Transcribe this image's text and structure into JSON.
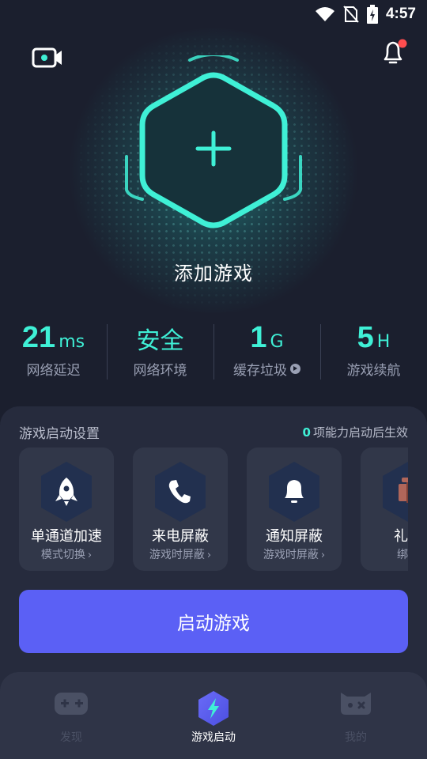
{
  "status_bar": {
    "time": "4:57"
  },
  "hero": {
    "add_game_label": "添加游戏"
  },
  "stats": [
    {
      "value": "21",
      "unit": "ms",
      "label": "网络延迟"
    },
    {
      "value": "安全",
      "unit": "",
      "label": "网络环境"
    },
    {
      "value": "1",
      "unit": "G",
      "label": "缓存垃圾"
    },
    {
      "value": "5",
      "unit": "H",
      "label": "游戏续航"
    }
  ],
  "settings": {
    "title": "游戏启动设置",
    "note_count": "0",
    "note_text": "项能力启动后生效",
    "cards": [
      {
        "title": "单通道加速",
        "subtitle": "模式切换",
        "icon": "rocket-icon"
      },
      {
        "title": "来电屏蔽",
        "subtitle": "游戏时屏蔽",
        "icon": "phone-icon"
      },
      {
        "title": "通知屏蔽",
        "subtitle": "游戏时屏蔽",
        "icon": "bell-icon"
      },
      {
        "title": "礼包",
        "subtitle": "绑定",
        "icon": "gift-icon"
      }
    ]
  },
  "start_button": {
    "label": "启动游戏"
  },
  "tabbar": {
    "items": [
      {
        "label": "发现",
        "icon": "gamepad-icon",
        "active": false
      },
      {
        "label": "游戏启动",
        "icon": "lightning-hex-icon",
        "active": true
      },
      {
        "label": "我的",
        "icon": "profile-controller-icon",
        "active": false
      }
    ]
  },
  "colors": {
    "accent": "#3ff0d6",
    "button": "#5b60f5",
    "background": "#1b1f2e",
    "notification_dot": "#ff4d4f"
  }
}
